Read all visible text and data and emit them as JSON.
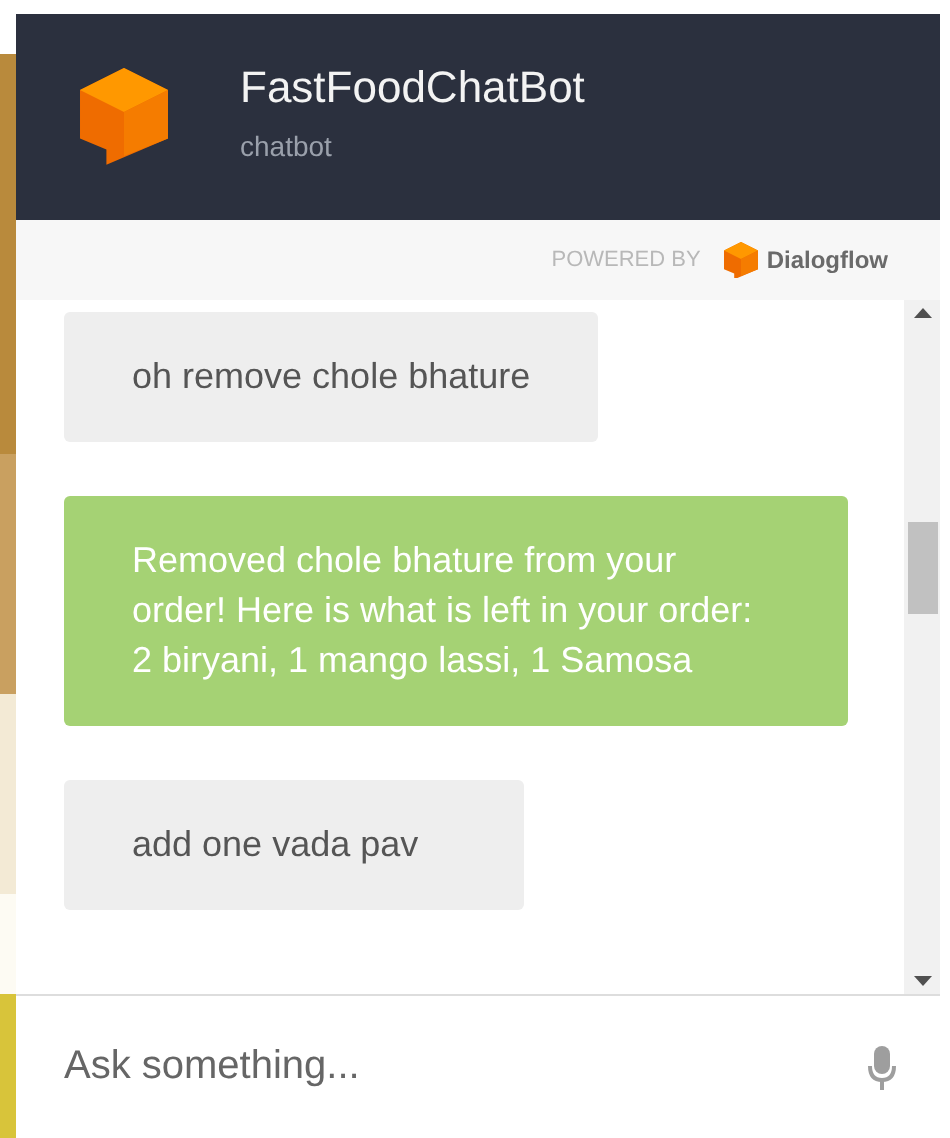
{
  "header": {
    "title": "FastFoodChatBot",
    "subtitle": "chatbot"
  },
  "powered_by": {
    "label": "POWERED BY",
    "brand": "Dialogflow"
  },
  "messages": [
    {
      "kind": "user",
      "text": "oh remove chole bhature"
    },
    {
      "kind": "bot",
      "text": "Removed chole bhature from your order! Here is what is left in your order: 2 biryani, 1 mango lassi, 1 Samosa"
    },
    {
      "kind": "user",
      "text": "add one vada pav"
    }
  ],
  "input": {
    "placeholder": "Ask something..."
  }
}
